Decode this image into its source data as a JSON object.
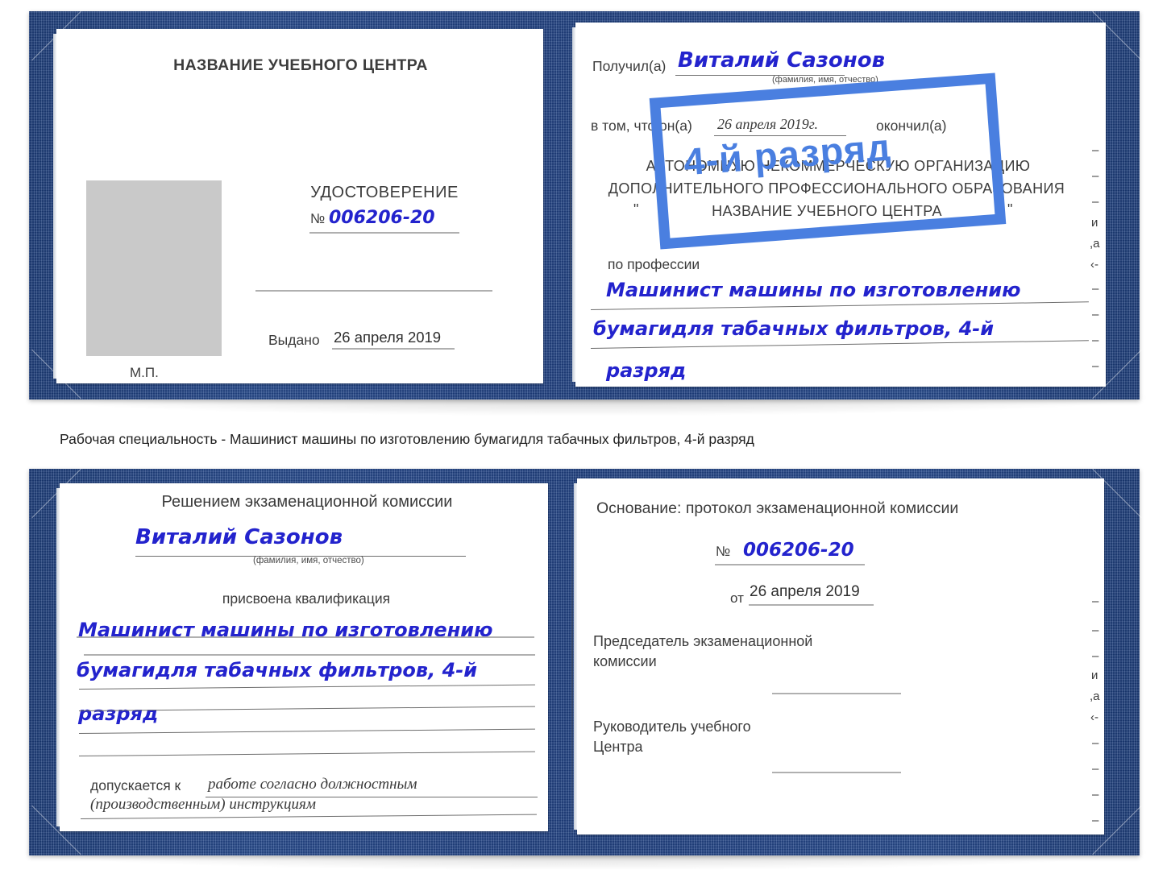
{
  "document": {
    "type": "certificate-scan",
    "caption": "Рабочая специальность - Машинист машины по изготовлению бумагидля табачных фильтров, 4-й разряд"
  },
  "colors": {
    "cover_blue": "#1e3f80",
    "ink_blue": "#2323cd",
    "stamp_blue": "#4a7fe0",
    "photo_placeholder_gray": "#c9c9c9",
    "rule_gray": "#9a9a9a"
  },
  "certificate_top": {
    "left_page": {
      "center_name": "НАЗВАНИЕ УЧЕБНОГО ЦЕНТРА",
      "doc_title": "УДОСТОВЕРЕНИЕ",
      "number_symbol": "№",
      "number_value": "006206-20",
      "issued_label": "Выдано",
      "issued_value": "26 апреля 2019",
      "seal_label": "М.П."
    },
    "right_page": {
      "received_label": "Получил(а)",
      "received_value": "Виталий Сазонов",
      "fio_hint": "(фамилия, имя, отчество)",
      "that_label": "в том, что он(а)",
      "that_date": "26 апреля 2019г.",
      "finished_label": "окончил(а)",
      "org_line1": "АВТОНОМНУЮ НЕКОММЕРЧЕСКУЮ ОРГАНИЗАЦИЮ",
      "org_line2": "ДОПОЛНИТЕЛЬНОГО ПРОФЕССИОНАЛЬНОГО ОБРАЗОВАНИЯ",
      "org_quote_open": "\"",
      "org_name": "НАЗВАНИЕ УЧЕБНОГО ЦЕНТРА",
      "org_quote_close": "\"",
      "profession_label": "по профессии",
      "profession_line1": "Машинист машины по изготовлению",
      "profession_line2": "бумагидля табачных фильтров, 4-й",
      "profession_line3": "разряд",
      "stamp_text": "4-й разряд",
      "edge_glyphs": [
        "–",
        "–",
        "–",
        "и",
        ",а",
        "‹-",
        "–",
        "–",
        "–",
        "–"
      ]
    }
  },
  "certificate_bottom": {
    "left_page": {
      "heading": "Решением экзаменационной комиссии",
      "name_value": "Виталий Сазонов",
      "fio_hint": "(фамилия, имя, отчество)",
      "qualification_label": "присвоена квалификация",
      "qualification_line1": "Машинист машины по изготовлению",
      "qualification_line2": "бумагидля табачных фильтров, 4-й",
      "qualification_line3": "разряд",
      "admitted_label": "допускается к",
      "admitted_value_line1": "работе согласно должностным",
      "admitted_value_line2": "(производственным) инструкциям"
    },
    "right_page": {
      "basis_label": "Основание: протокол экзаменационной комиссии",
      "number_symbol": "№",
      "number_value": "006206-20",
      "date_label": "от",
      "date_value": "26 апреля 2019",
      "chairman_line1": "Председатель экзаменационной",
      "chairman_line2": "комиссии",
      "head_line1": "Руководитель учебного",
      "head_line2": "Центра",
      "edge_glyphs": [
        "–",
        "–",
        "–",
        "и",
        ",а",
        "‹-",
        "–",
        "–",
        "–",
        "–"
      ]
    }
  }
}
